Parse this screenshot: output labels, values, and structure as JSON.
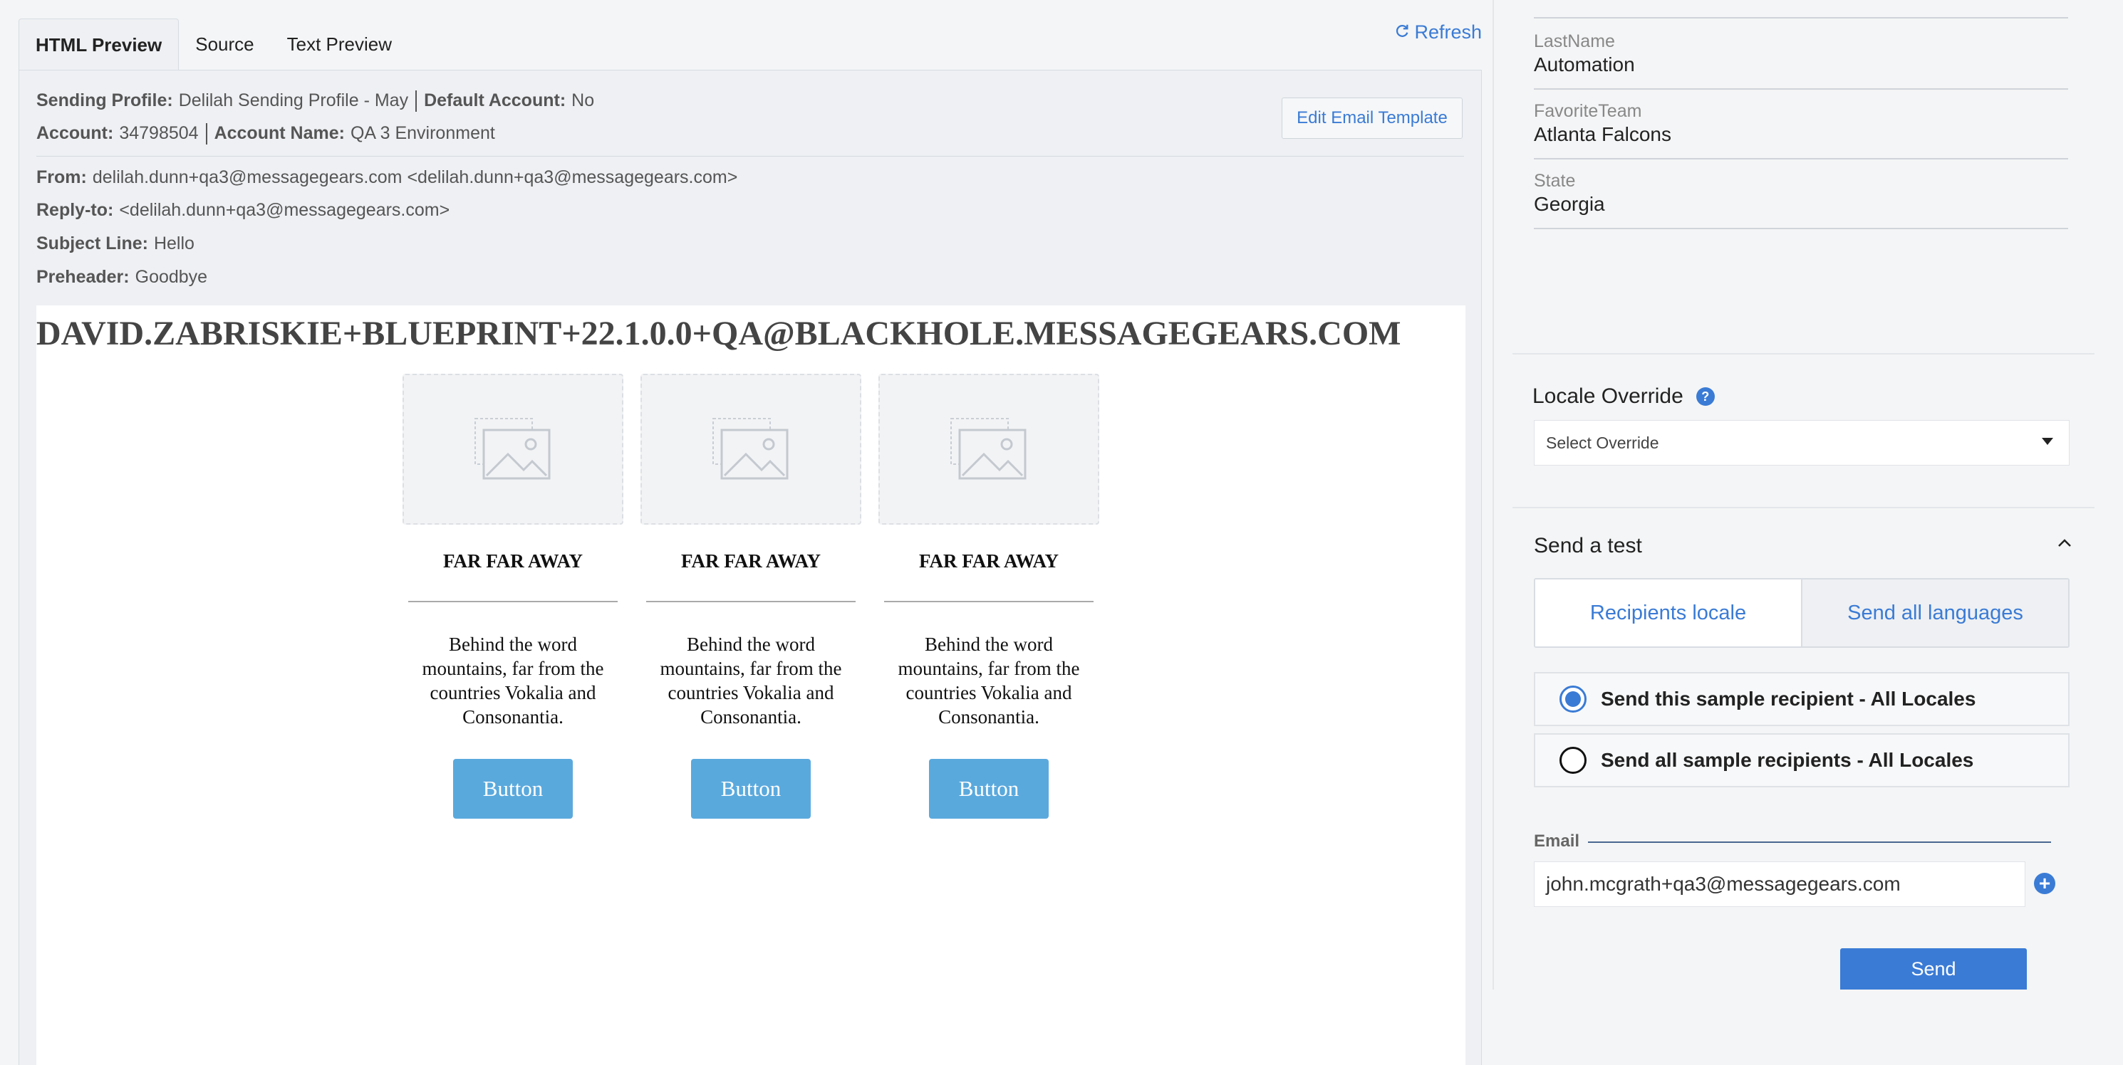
{
  "tabs": [
    "HTML Preview",
    "Source",
    "Text Preview"
  ],
  "refresh_label": "Refresh",
  "meta": {
    "sending_profile_label": "Sending Profile:",
    "sending_profile": "Delilah Sending Profile - May",
    "default_account_label": "Default Account:",
    "default_account": "No",
    "account_label": "Account:",
    "account": "34798504",
    "account_name_label": "Account Name:",
    "account_name": "QA 3 Environment",
    "from_label": "From:",
    "from": "delilah.dunn+qa3@messagegears.com <delilah.dunn+qa3@messagegears.com>",
    "reply_to_label": "Reply-to:",
    "reply_to": "<delilah.dunn+qa3@messagegears.com>",
    "subject_label": "Subject Line:",
    "subject": "Hello",
    "preheader_label": "Preheader:",
    "preheader": "Goodbye"
  },
  "edit_template_label": "Edit Email Template",
  "email": {
    "title": "DAVID.ZABRISKIE+BLUEPRINT+22.1.0.0+QA@BLACKHOLE.MESSAGEGEARS.COM",
    "columns": [
      {
        "heading": "FAR FAR AWAY",
        "text": "Behind the word mountains, far from the countries Vokalia and Consonantia.",
        "button": "Button"
      },
      {
        "heading": "FAR FAR AWAY",
        "text": "Behind the word mountains, far from the countries Vokalia and Consonantia.",
        "button": "Button"
      },
      {
        "heading": "FAR FAR AWAY",
        "text": "Behind the word mountains, far from the countries Vokalia and Consonantia.",
        "button": "Button"
      }
    ]
  },
  "recipient_fields": [
    {
      "label": "LastName",
      "value": "Automation"
    },
    {
      "label": "FavoriteTeam",
      "value": "Atlanta Falcons"
    },
    {
      "label": "State",
      "value": "Georgia"
    }
  ],
  "locale": {
    "title": "Locale Override",
    "help_icon": "?",
    "select_placeholder": "Select Override"
  },
  "send_test": {
    "title": "Send a test",
    "toggle": [
      "Recipients locale",
      "Send all languages"
    ],
    "radio_options": [
      "Send this sample recipient - All Locales",
      "Send all sample recipients - All Locales"
    ],
    "selected_radio": 0,
    "email_label": "Email",
    "email_value": "john.mcgrath+qa3@messagegears.com",
    "add_icon": "+",
    "send_label": "Send"
  },
  "colors": {
    "accent": "#3a7bd5",
    "email_button": "#5aa9dd"
  }
}
